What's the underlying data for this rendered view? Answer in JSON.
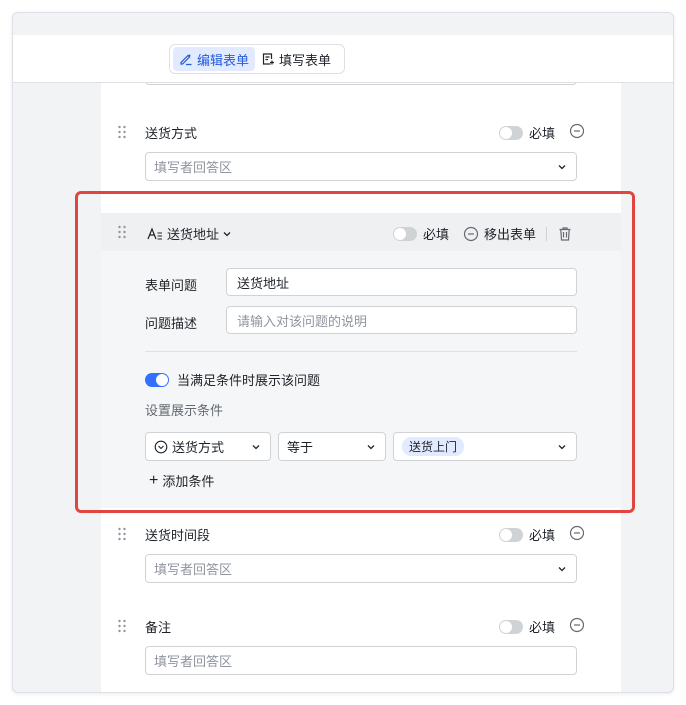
{
  "header": {
    "edit_form": "编辑表单",
    "fill_form": "填写表单"
  },
  "questions": {
    "delivery_method": {
      "title": "送货方式",
      "required_label": "必填",
      "placeholder": "填写者回答区"
    },
    "delivery_address": {
      "type_title": "送货地址",
      "required_label": "必填",
      "remove_label": "移出表单",
      "form_question_label": "表单问题",
      "form_question_value": "送货地址",
      "description_label": "问题描述",
      "description_placeholder": "请输入对该问题的说明",
      "condition_toggle_label": "当满足条件时展示该问题",
      "condition_toggle_on": true,
      "set_condition_label": "设置展示条件",
      "condition": {
        "field": "送货方式",
        "operator": "等于",
        "value": "送货上门"
      },
      "add_condition": "添加条件"
    },
    "delivery_time": {
      "title": "送货时间段",
      "required_label": "必填",
      "placeholder": "填写者回答区"
    },
    "remarks": {
      "title": "备注",
      "required_label": "必填",
      "placeholder": "填写者回答区"
    }
  },
  "colors": {
    "accent": "#3370ff",
    "active_tab_bg": "#e1eaff",
    "highlight_border": "#e0463f"
  }
}
